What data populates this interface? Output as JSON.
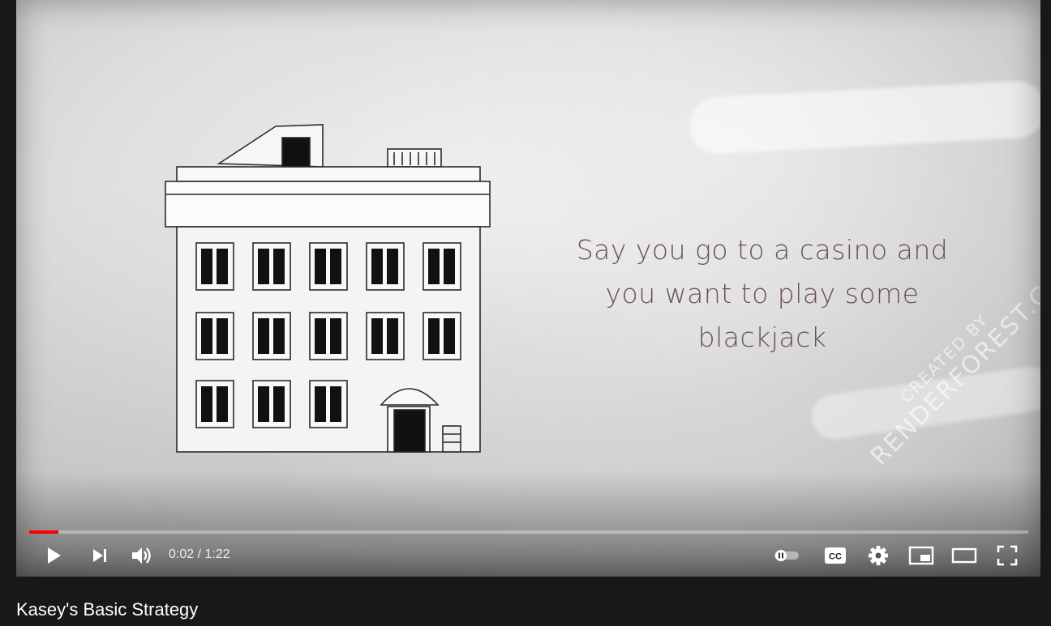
{
  "video": {
    "caption_lines": [
      "Say you go to a casino and",
      "you want to play some",
      "blackjack"
    ],
    "watermark_line1": "CREATED BY",
    "watermark_line2": "RENDERFOREST.COM"
  },
  "player": {
    "current_time": "0:02",
    "duration": "1:22",
    "time_separator": " / ",
    "progress_fraction": 0.029,
    "accent_color": "#ff0000",
    "left_controls": [
      "play-icon",
      "next-icon",
      "volume-icon"
    ],
    "right_controls": [
      "autoplay-toggle-icon",
      "subtitles-icon",
      "settings-icon",
      "miniplayer-icon",
      "theater-mode-icon",
      "fullscreen-icon"
    ],
    "cc_label": "CC"
  },
  "title": "Kasey's Basic Strategy"
}
